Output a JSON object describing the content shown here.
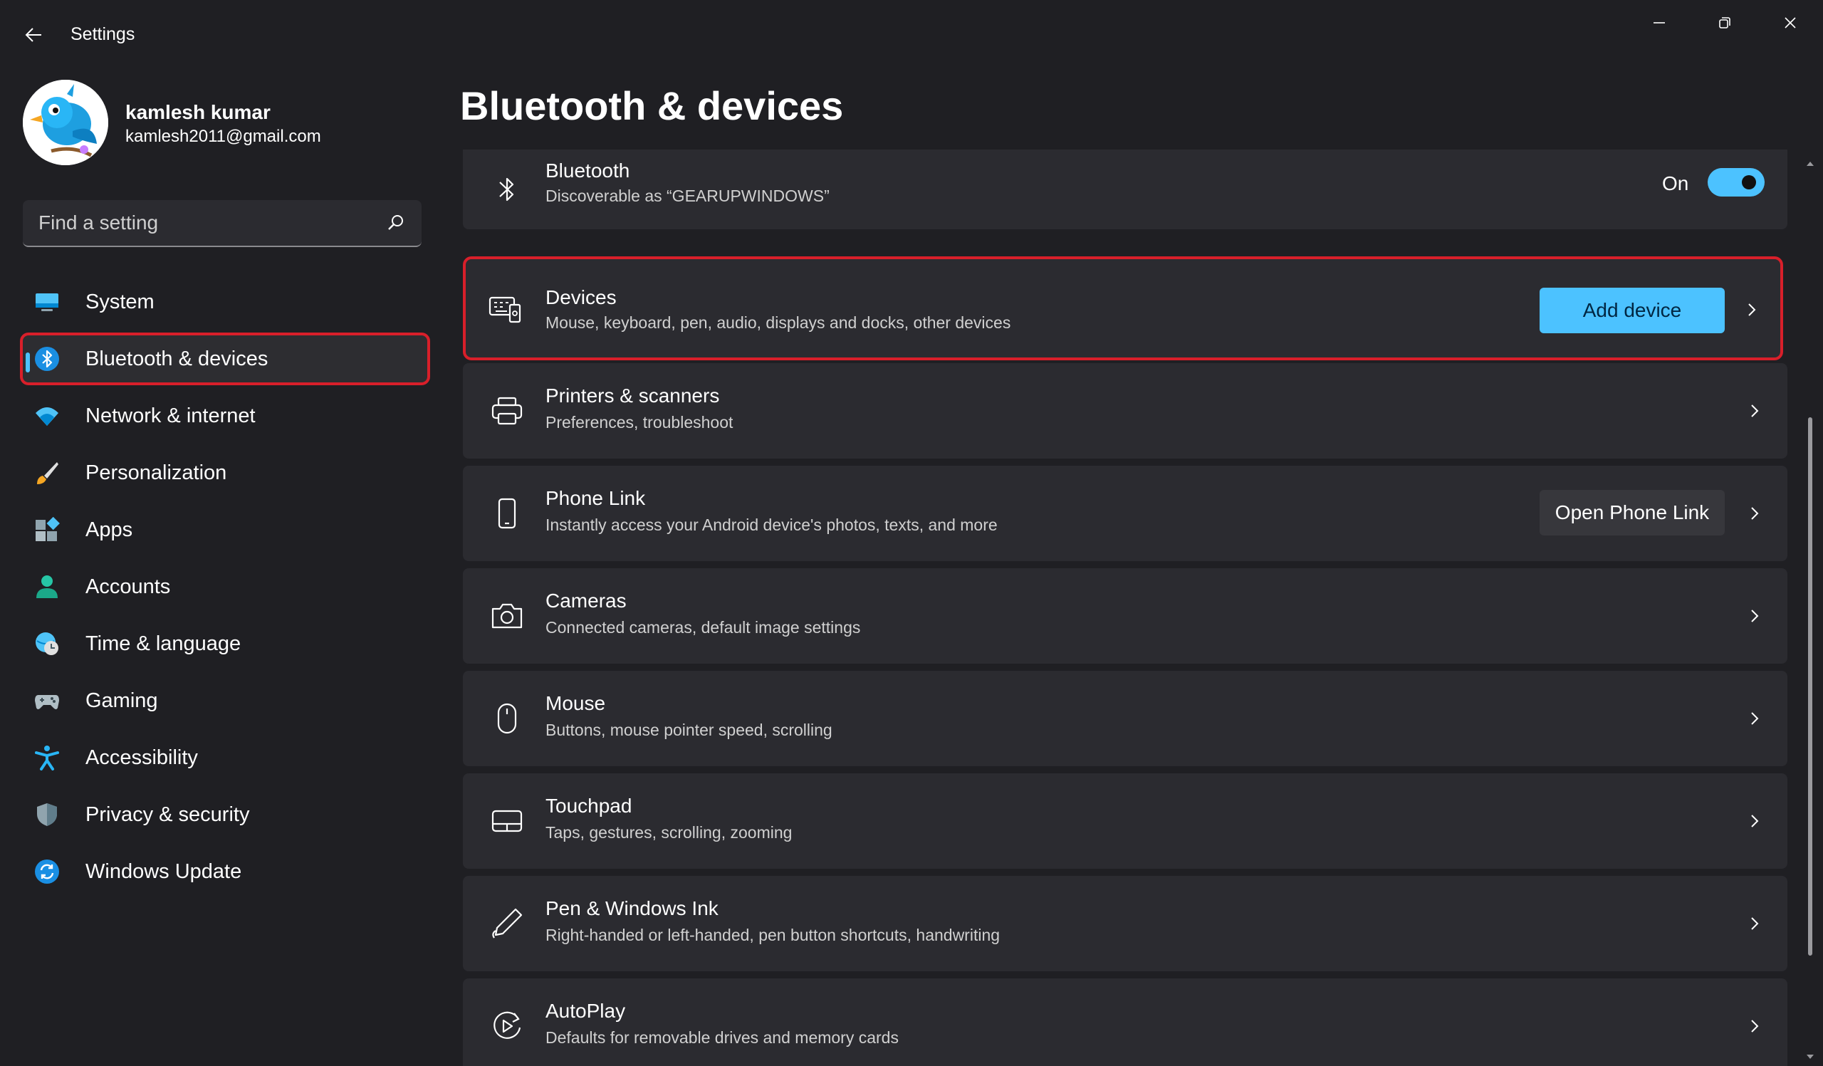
{
  "window": {
    "title": "Settings",
    "controls": [
      "minimize-icon",
      "restore-icon",
      "close-icon"
    ]
  },
  "profile": {
    "name": "kamlesh kumar",
    "email": "kamlesh2011@gmail.com"
  },
  "search": {
    "placeholder": "Find a setting",
    "value": ""
  },
  "sidebar": {
    "items": [
      {
        "label": "System",
        "icon": "system-icon",
        "selected": false
      },
      {
        "label": "Bluetooth & devices",
        "icon": "bluetooth-icon",
        "selected": true
      },
      {
        "label": "Network & internet",
        "icon": "wifi-icon",
        "selected": false
      },
      {
        "label": "Personalization",
        "icon": "brush-icon",
        "selected": false
      },
      {
        "label": "Apps",
        "icon": "apps-icon",
        "selected": false
      },
      {
        "label": "Accounts",
        "icon": "person-icon",
        "selected": false
      },
      {
        "label": "Time & language",
        "icon": "globe-clock-icon",
        "selected": false
      },
      {
        "label": "Gaming",
        "icon": "gamepad-icon",
        "selected": false
      },
      {
        "label": "Accessibility",
        "icon": "accessibility-icon",
        "selected": false
      },
      {
        "label": "Privacy & security",
        "icon": "shield-icon",
        "selected": false
      },
      {
        "label": "Windows Update",
        "icon": "update-icon",
        "selected": false
      }
    ]
  },
  "main": {
    "title": "Bluetooth & devices",
    "bluetooth": {
      "title": "Bluetooth",
      "subtitle": "Discoverable as “GEARUPWINDOWS”",
      "toggle_label": "On",
      "toggle_on": true
    },
    "cards": [
      {
        "title": "Devices",
        "subtitle": "Mouse, keyboard, pen, audio, displays and docks, other devices",
        "button": "Add device",
        "icon": "devices-icon"
      },
      {
        "title": "Printers & scanners",
        "subtitle": "Preferences, troubleshoot",
        "icon": "printer-icon"
      },
      {
        "title": "Phone Link",
        "subtitle": "Instantly access your Android device's photos, texts, and more",
        "button": "Open Phone Link",
        "icon": "phone-icon"
      },
      {
        "title": "Cameras",
        "subtitle": "Connected cameras, default image settings",
        "icon": "camera-icon"
      },
      {
        "title": "Mouse",
        "subtitle": "Buttons, mouse pointer speed, scrolling",
        "icon": "mouse-icon"
      },
      {
        "title": "Touchpad",
        "subtitle": "Taps, gestures, scrolling, zooming",
        "icon": "touchpad-icon"
      },
      {
        "title": "Pen & Windows Ink",
        "subtitle": "Right-handed or left-handed, pen button shortcuts, handwriting",
        "icon": "pen-icon"
      },
      {
        "title": "AutoPlay",
        "subtitle": "Defaults for removable drives and memory cards",
        "icon": "autoplay-icon"
      }
    ]
  },
  "colors": {
    "accent": "#4cc2ff",
    "highlight_border": "#d81f2a",
    "background": "#1f1f23",
    "card": "#2b2b30"
  }
}
